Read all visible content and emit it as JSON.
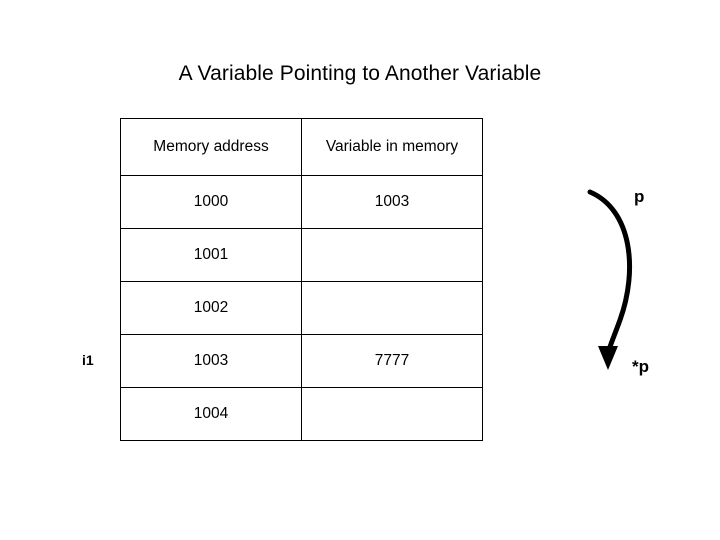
{
  "slide": {
    "title": "A Variable Pointing to Another Variable",
    "background_color": "#ffffff",
    "text_color": "#000000"
  },
  "table": {
    "headers": [
      "Memory address",
      "Variable in memory"
    ],
    "rows": [
      {
        "address": "1000",
        "value": "1003"
      },
      {
        "address": "1001",
        "value": ""
      },
      {
        "address": "1002",
        "value": ""
      },
      {
        "address": "1003",
        "value": "7777"
      },
      {
        "address": "1004",
        "value": ""
      }
    ]
  },
  "annotations": {
    "left_label": "i1",
    "pointer_label": "p",
    "deref_label": "*p",
    "arrow": "curved-arrow-down"
  }
}
